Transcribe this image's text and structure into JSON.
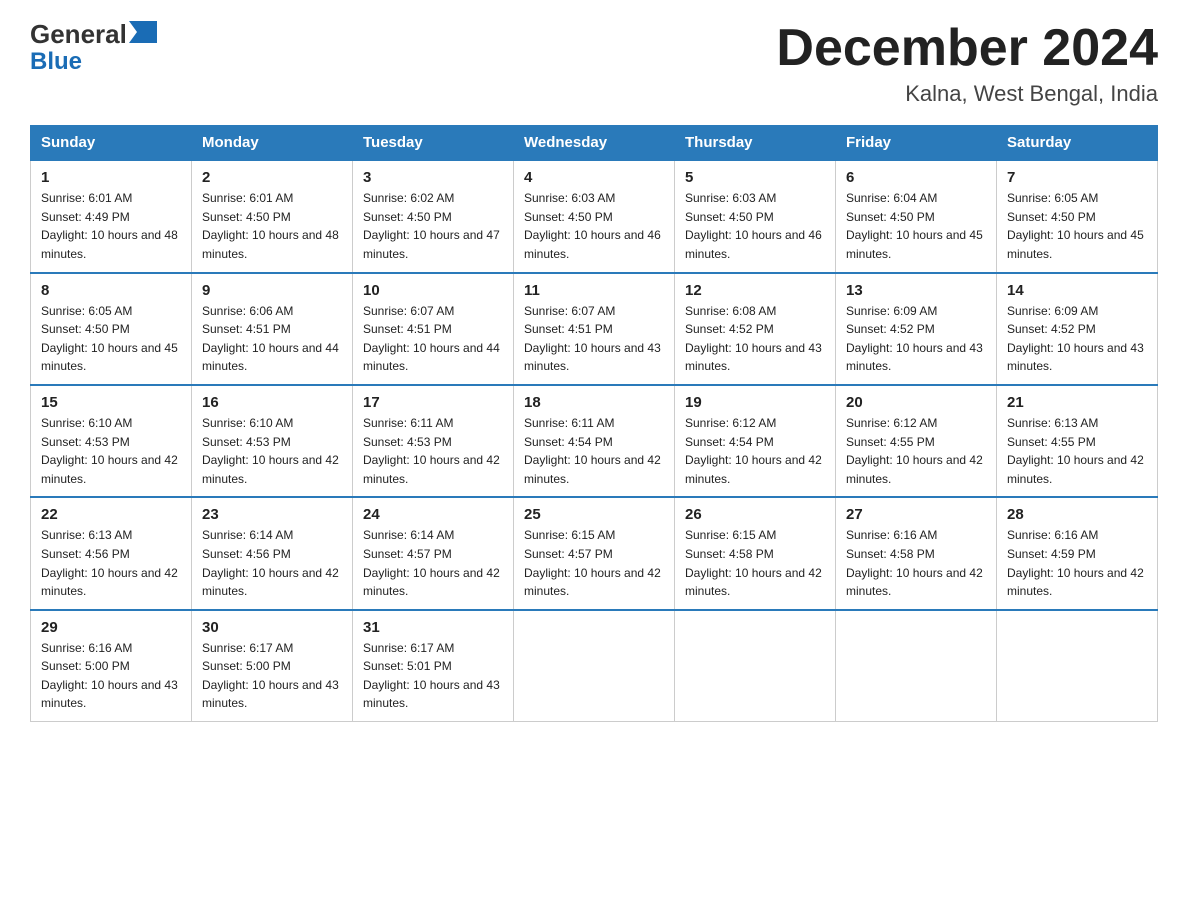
{
  "logo": {
    "text_general": "General",
    "text_blue": "Blue",
    "alt": "GeneralBlue logo"
  },
  "header": {
    "month_year": "December 2024",
    "location": "Kalna, West Bengal, India"
  },
  "days_of_week": [
    "Sunday",
    "Monday",
    "Tuesday",
    "Wednesday",
    "Thursday",
    "Friday",
    "Saturday"
  ],
  "weeks": [
    [
      {
        "day": "1",
        "sunrise": "6:01 AM",
        "sunset": "4:49 PM",
        "daylight": "10 hours and 48 minutes."
      },
      {
        "day": "2",
        "sunrise": "6:01 AM",
        "sunset": "4:50 PM",
        "daylight": "10 hours and 48 minutes."
      },
      {
        "day": "3",
        "sunrise": "6:02 AM",
        "sunset": "4:50 PM",
        "daylight": "10 hours and 47 minutes."
      },
      {
        "day": "4",
        "sunrise": "6:03 AM",
        "sunset": "4:50 PM",
        "daylight": "10 hours and 46 minutes."
      },
      {
        "day": "5",
        "sunrise": "6:03 AM",
        "sunset": "4:50 PM",
        "daylight": "10 hours and 46 minutes."
      },
      {
        "day": "6",
        "sunrise": "6:04 AM",
        "sunset": "4:50 PM",
        "daylight": "10 hours and 45 minutes."
      },
      {
        "day": "7",
        "sunrise": "6:05 AM",
        "sunset": "4:50 PM",
        "daylight": "10 hours and 45 minutes."
      }
    ],
    [
      {
        "day": "8",
        "sunrise": "6:05 AM",
        "sunset": "4:50 PM",
        "daylight": "10 hours and 45 minutes."
      },
      {
        "day": "9",
        "sunrise": "6:06 AM",
        "sunset": "4:51 PM",
        "daylight": "10 hours and 44 minutes."
      },
      {
        "day": "10",
        "sunrise": "6:07 AM",
        "sunset": "4:51 PM",
        "daylight": "10 hours and 44 minutes."
      },
      {
        "day": "11",
        "sunrise": "6:07 AM",
        "sunset": "4:51 PM",
        "daylight": "10 hours and 43 minutes."
      },
      {
        "day": "12",
        "sunrise": "6:08 AM",
        "sunset": "4:52 PM",
        "daylight": "10 hours and 43 minutes."
      },
      {
        "day": "13",
        "sunrise": "6:09 AM",
        "sunset": "4:52 PM",
        "daylight": "10 hours and 43 minutes."
      },
      {
        "day": "14",
        "sunrise": "6:09 AM",
        "sunset": "4:52 PM",
        "daylight": "10 hours and 43 minutes."
      }
    ],
    [
      {
        "day": "15",
        "sunrise": "6:10 AM",
        "sunset": "4:53 PM",
        "daylight": "10 hours and 42 minutes."
      },
      {
        "day": "16",
        "sunrise": "6:10 AM",
        "sunset": "4:53 PM",
        "daylight": "10 hours and 42 minutes."
      },
      {
        "day": "17",
        "sunrise": "6:11 AM",
        "sunset": "4:53 PM",
        "daylight": "10 hours and 42 minutes."
      },
      {
        "day": "18",
        "sunrise": "6:11 AM",
        "sunset": "4:54 PM",
        "daylight": "10 hours and 42 minutes."
      },
      {
        "day": "19",
        "sunrise": "6:12 AM",
        "sunset": "4:54 PM",
        "daylight": "10 hours and 42 minutes."
      },
      {
        "day": "20",
        "sunrise": "6:12 AM",
        "sunset": "4:55 PM",
        "daylight": "10 hours and 42 minutes."
      },
      {
        "day": "21",
        "sunrise": "6:13 AM",
        "sunset": "4:55 PM",
        "daylight": "10 hours and 42 minutes."
      }
    ],
    [
      {
        "day": "22",
        "sunrise": "6:13 AM",
        "sunset": "4:56 PM",
        "daylight": "10 hours and 42 minutes."
      },
      {
        "day": "23",
        "sunrise": "6:14 AM",
        "sunset": "4:56 PM",
        "daylight": "10 hours and 42 minutes."
      },
      {
        "day": "24",
        "sunrise": "6:14 AM",
        "sunset": "4:57 PM",
        "daylight": "10 hours and 42 minutes."
      },
      {
        "day": "25",
        "sunrise": "6:15 AM",
        "sunset": "4:57 PM",
        "daylight": "10 hours and 42 minutes."
      },
      {
        "day": "26",
        "sunrise": "6:15 AM",
        "sunset": "4:58 PM",
        "daylight": "10 hours and 42 minutes."
      },
      {
        "day": "27",
        "sunrise": "6:16 AM",
        "sunset": "4:58 PM",
        "daylight": "10 hours and 42 minutes."
      },
      {
        "day": "28",
        "sunrise": "6:16 AM",
        "sunset": "4:59 PM",
        "daylight": "10 hours and 42 minutes."
      }
    ],
    [
      {
        "day": "29",
        "sunrise": "6:16 AM",
        "sunset": "5:00 PM",
        "daylight": "10 hours and 43 minutes."
      },
      {
        "day": "30",
        "sunrise": "6:17 AM",
        "sunset": "5:00 PM",
        "daylight": "10 hours and 43 minutes."
      },
      {
        "day": "31",
        "sunrise": "6:17 AM",
        "sunset": "5:01 PM",
        "daylight": "10 hours and 43 minutes."
      },
      null,
      null,
      null,
      null
    ]
  ]
}
